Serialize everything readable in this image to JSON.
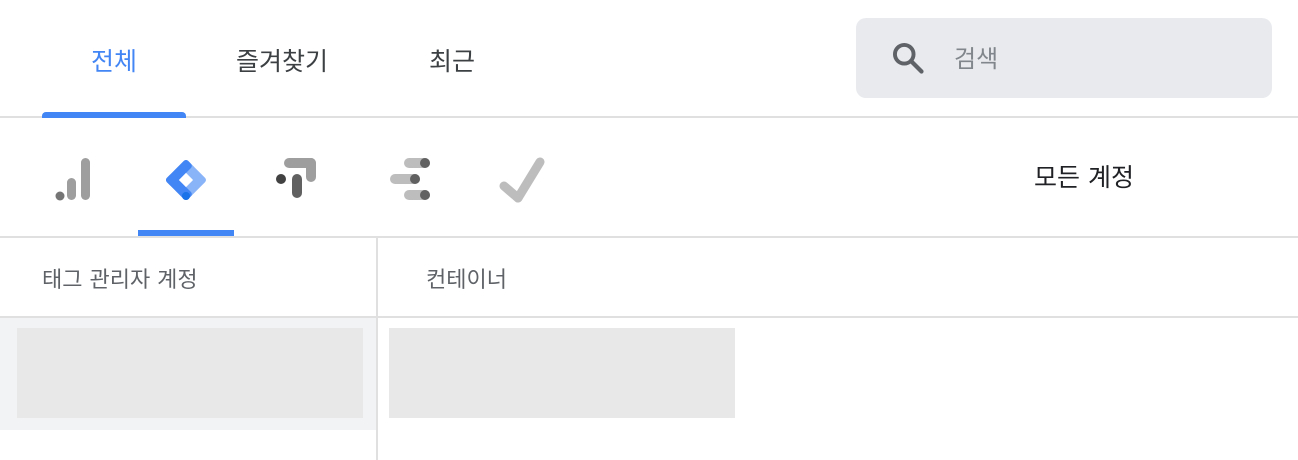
{
  "tabs": [
    {
      "label": "전체",
      "active": true
    },
    {
      "label": "즐겨찾기",
      "active": false
    },
    {
      "label": "최근",
      "active": false
    }
  ],
  "search": {
    "placeholder": "검색",
    "value": ""
  },
  "products": [
    {
      "icon": "analytics-icon"
    },
    {
      "icon": "tag-manager-icon",
      "active": true
    },
    {
      "icon": "optimize-icon"
    },
    {
      "icon": "data-studio-icon"
    },
    {
      "icon": "surveys-icon"
    }
  ],
  "accounts_filter": "모든 계정",
  "columns": {
    "accounts": "태그 관리자 계정",
    "containers": "컨테이너"
  },
  "colors": {
    "accent": "#4285f4",
    "divider": "#e0e0e0",
    "search_bg": "#e8eaed"
  }
}
